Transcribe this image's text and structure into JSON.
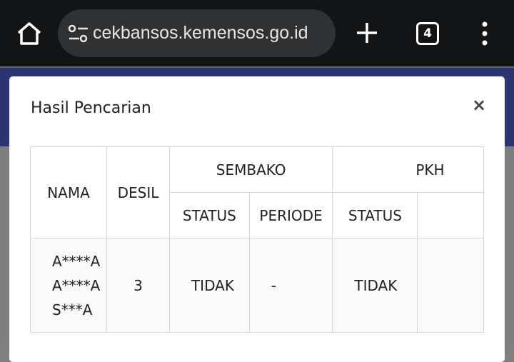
{
  "browser": {
    "url": "cekbansos.kemensos.go.id",
    "tab_count": "4"
  },
  "modal": {
    "title": "Hasil Pencarian",
    "close_label": "×"
  },
  "table": {
    "headers": {
      "nama": "NAMA",
      "desil": "DESIL",
      "group1": "SEMBAKO",
      "group1_status": "STATUS",
      "group1_periode": "PERIODE",
      "group2": "PKH",
      "group2_status": "STATUS"
    },
    "rows": [
      {
        "nama_lines": [
          "A****A",
          "A****A",
          "S***A"
        ],
        "desil": "3",
        "sembako_status": "TIDAK",
        "sembako_periode": "-",
        "group2_status": "TIDAK"
      }
    ]
  }
}
